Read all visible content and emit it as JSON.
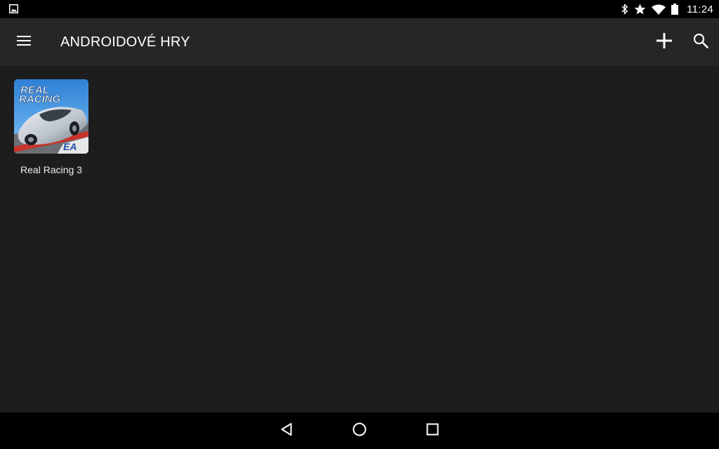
{
  "status_bar": {
    "time": "11:24",
    "icons": [
      "gallery-notification-icon",
      "bluetooth-icon",
      "star-icon",
      "wifi-icon",
      "battery-icon"
    ]
  },
  "app_bar": {
    "title": "ANDROIDOVÉ HRY",
    "menu_icon": "hamburger-menu-icon",
    "actions": [
      "add-icon",
      "search-icon"
    ]
  },
  "games": [
    {
      "name": "Real Racing 3",
      "icon_text_line1": "REAL",
      "icon_text_line2": "RACING",
      "icon_publisher": "EA"
    }
  ],
  "nav_bar": {
    "buttons": [
      "back-icon",
      "home-icon",
      "recents-icon"
    ]
  },
  "colors": {
    "status_bar_bg": "#000000",
    "app_bar_bg": "#262626",
    "content_bg": "#1d1d1d",
    "nav_bar_bg": "#000000",
    "text": "#ffffff"
  }
}
